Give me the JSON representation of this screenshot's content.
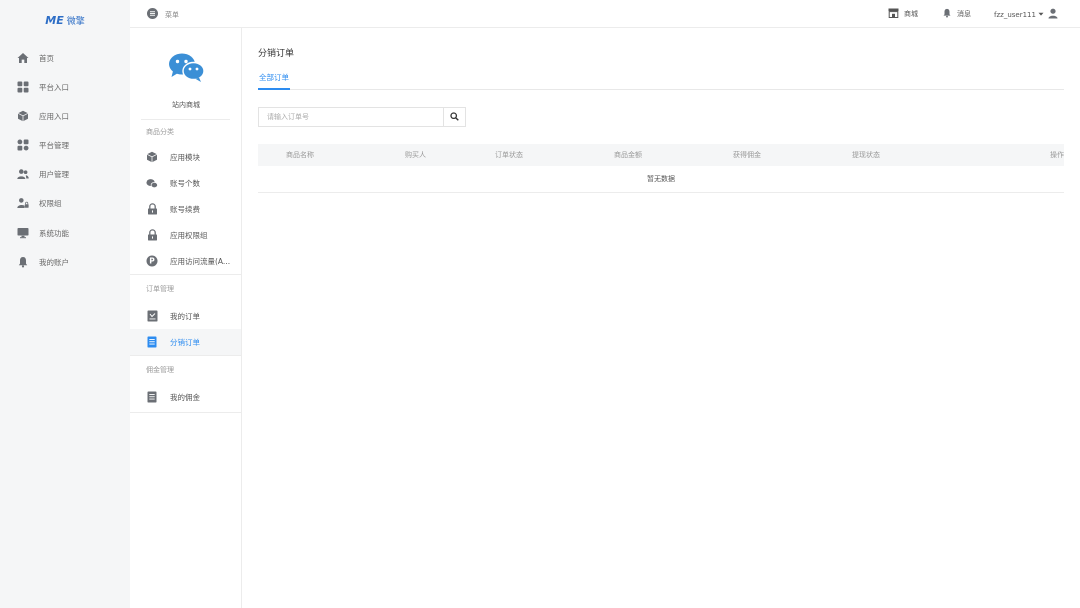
{
  "brand": {
    "mark": "ME",
    "name": "微擎"
  },
  "main_nav": [
    {
      "label": "首页",
      "icon": "home-icon"
    },
    {
      "label": "平台入口",
      "icon": "grid-icon"
    },
    {
      "label": "应用入口",
      "icon": "cube-icon"
    },
    {
      "label": "平台管理",
      "icon": "grid-icon"
    },
    {
      "label": "用户管理",
      "icon": "users-icon"
    },
    {
      "label": "权限组",
      "icon": "user-lock-icon"
    },
    {
      "label": "系统功能",
      "icon": "monitor-icon"
    },
    {
      "label": "我的账户",
      "icon": "bell-icon"
    }
  ],
  "topbar": {
    "menu_label": "菜单",
    "store_label": "商城",
    "message_label": "消息",
    "username": "fzz_user111"
  },
  "sub_sidebar": {
    "store_name": "站内商城",
    "section_products": "商品分类",
    "products": [
      {
        "label": "应用模块",
        "icon": "cube-icon"
      },
      {
        "label": "账号个数",
        "icon": "chat-icon"
      },
      {
        "label": "账号续费",
        "icon": "lock-icon"
      },
      {
        "label": "应用权限组",
        "icon": "lock-icon"
      },
      {
        "label": "应用访问流量(A...",
        "icon": "coin-icon"
      }
    ],
    "section_orders": "订单管理",
    "orders": [
      {
        "label": "我的订单",
        "icon": "order-icon"
      },
      {
        "label": "分销订单",
        "icon": "doc-icon"
      }
    ],
    "section_commission": "佣金管理",
    "commission": [
      {
        "label": "我的佣金",
        "icon": "doc-icon"
      }
    ]
  },
  "content": {
    "page_title": "分销订单",
    "tab_all": "全部订单",
    "search_placeholder": "请输入订单号",
    "columns": [
      "商品名称",
      "购买人",
      "订单状态",
      "商品金额",
      "获得佣金",
      "提现状态",
      "操作"
    ],
    "empty_text": "暂无数据"
  },
  "colors": {
    "accent": "#2d8cf0",
    "brand": "#2d6ec6",
    "sidebar_bg": "#f5f6f7"
  }
}
